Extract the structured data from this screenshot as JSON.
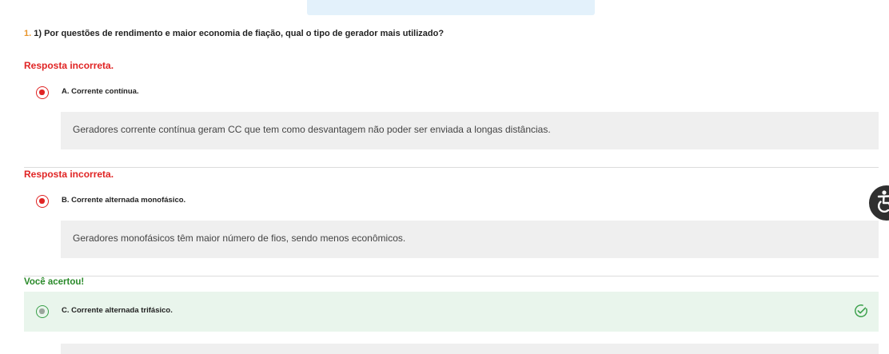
{
  "question": {
    "number": "1.",
    "text": "1) Por questões de rendimento e maior economia de fiação, qual o tipo de gerador mais utilizado?"
  },
  "answers": [
    {
      "status": "Resposta incorreta.",
      "label": "A. Corrente contínua.",
      "feedback": "Geradores corrente contínua geram CC que tem como desvantagem não poder ser enviada a longas distâncias."
    },
    {
      "status": "Resposta incorreta.",
      "label": "B. Corrente alternada monofásico.",
      "feedback": "Geradores monofásicos têm maior número de fios, sendo menos econômicos."
    },
    {
      "status": "Você acertou!",
      "label": "C. Corrente alternada trifásico.",
      "feedback": ""
    }
  ],
  "icons": {
    "incorrect_radio": "radio-selected-icon",
    "correct_radio": "radio-selected-icon",
    "correct_check": "check-circle-icon",
    "accessibility": "accessibility-icon"
  },
  "colors": {
    "incorrect": "#e02424",
    "correct": "#2a8a2a",
    "question_number": "#e8952a",
    "feedback_bg": "#efefef",
    "correct_bg": "#e9f5ec",
    "banner_bg": "#e3f1fb"
  }
}
